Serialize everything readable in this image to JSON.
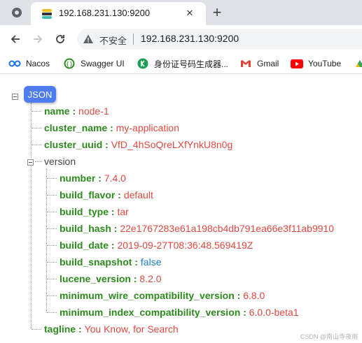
{
  "browser": {
    "tab_title": "192.168.231.130:9200",
    "insecure_label": "不安全",
    "url": "192.168.231.130:9200",
    "bookmarks": [
      {
        "label": "Nacos",
        "icon": "nacos-icon"
      },
      {
        "label": "Swagger UI",
        "icon": "swagger-icon"
      },
      {
        "label": "身份证号码生成器...",
        "icon": "green-k-icon"
      },
      {
        "label": "Gmail",
        "icon": "gmail-icon"
      },
      {
        "label": "YouTube",
        "icon": "youtube-icon"
      }
    ]
  },
  "viewer": {
    "root_badge": "JSON",
    "separator": " : ",
    "name": {
      "key": "name",
      "value": "node-1"
    },
    "cluster_name": {
      "key": "cluster_name",
      "value": "my-application"
    },
    "cluster_uuid": {
      "key": "cluster_uuid",
      "value": "VfD_4hSoQreLXfYnkU8n0g"
    },
    "version_label": "version",
    "version": [
      {
        "key": "number",
        "value": "7.4.0",
        "type": "string"
      },
      {
        "key": "build_flavor",
        "value": "default",
        "type": "string"
      },
      {
        "key": "build_type",
        "value": "tar",
        "type": "string"
      },
      {
        "key": "build_hash",
        "value": "22e1767283e61a198cb4db791ea66e3f11ab9910",
        "type": "string"
      },
      {
        "key": "build_date",
        "value": "2019-09-27T08:36:48.569419Z",
        "type": "string"
      },
      {
        "key": "build_snapshot",
        "value": "false",
        "type": "boolean"
      },
      {
        "key": "lucene_version",
        "value": "8.2.0",
        "type": "string"
      },
      {
        "key": "minimum_wire_compatibility_version",
        "value": "6.8.0",
        "type": "string"
      },
      {
        "key": "minimum_index_compatibility_version",
        "value": "6.0.0-beta1",
        "type": "string"
      }
    ],
    "tagline": {
      "key": "tagline",
      "value": "You Know, for Search"
    }
  },
  "watermark": "CSDN @南山寺夜雨",
  "colors": {
    "key": "#2d8a1d",
    "string": "#e0493f",
    "boolean": "#1a7fc4",
    "badge": "#4d7cf5"
  }
}
